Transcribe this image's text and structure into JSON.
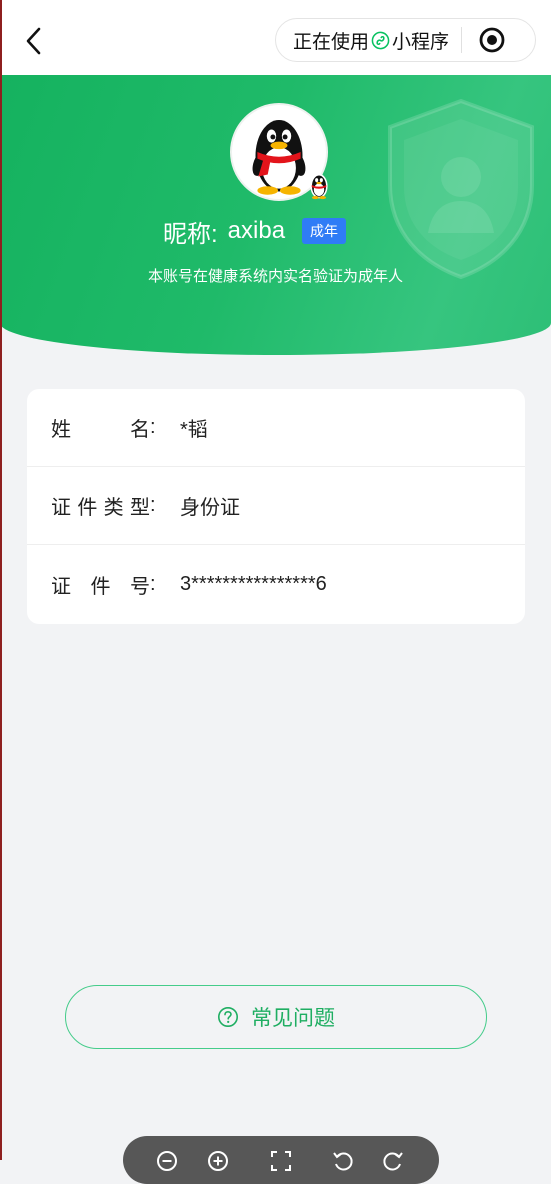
{
  "nav": {
    "capsule_using": "正在使用",
    "capsule_mini": "小程序"
  },
  "profile": {
    "nickname_label": "昵称:",
    "nickname": "axiba",
    "badge": "成年",
    "verify_note": "本账号在健康系统内实名验证为成年人"
  },
  "identity": {
    "separator": ":",
    "rows": [
      {
        "label": "姓名",
        "value": "*韬"
      },
      {
        "label": "证件类型",
        "value": "身份证"
      },
      {
        "label": "证件号",
        "value": "3****************6"
      }
    ]
  },
  "faq_button": {
    "label": "常见问题"
  },
  "colors": {
    "header_green": "#1fba69",
    "accent_green": "#1fae62",
    "badge_blue": "#2f7cf6",
    "page_bg": "#f2f3f5",
    "toolbar_bg": "#575757"
  },
  "icons": {
    "back": "back-chevron-icon",
    "miniprogram": "miniprogram-link-icon",
    "record": "record-target-icon",
    "shield": "shield-watermark-icon",
    "avatar": "qq-penguin-avatar",
    "help": "help-circle-icon",
    "toolbar": [
      "zoom-out-icon",
      "zoom-in-icon",
      "fit-screen-icon",
      "rotate-left-icon",
      "rotate-right-icon"
    ]
  }
}
